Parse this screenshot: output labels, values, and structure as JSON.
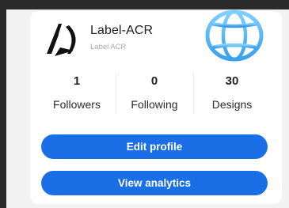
{
  "profile": {
    "name": "Label-ACR",
    "handle": "Label ACR",
    "logo_icon": "label-acr-logo-icon"
  },
  "overlay_icon": "globe-icon",
  "stats": [
    {
      "value": "1",
      "label": "Followers"
    },
    {
      "value": "0",
      "label": "Following"
    },
    {
      "value": "30",
      "label": "Designs"
    }
  ],
  "actions": {
    "edit_profile": "Edit profile",
    "view_analytics": "View analytics"
  },
  "colors": {
    "accent": "#1a6fe6",
    "globe": "#4fb6f2",
    "background": "#2b2b2b"
  }
}
